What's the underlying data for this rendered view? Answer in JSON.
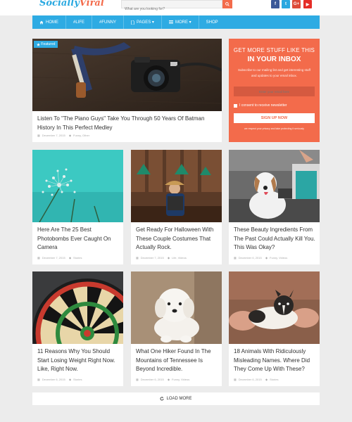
{
  "header": {
    "logo_part1": "Socially",
    "logo_part2": "Viral",
    "search_placeholder": "What are you looking for?"
  },
  "social": [
    {
      "icon": "facebook-icon",
      "glyph": "f",
      "color": "#3b5998"
    },
    {
      "icon": "twitter-icon",
      "glyph": "t",
      "color": "#29a8e0"
    },
    {
      "icon": "google-plus-icon",
      "glyph": "G+",
      "color": "#dd4b39"
    },
    {
      "icon": "youtube-icon",
      "glyph": "▶",
      "color": "#e52d27"
    }
  ],
  "nav": {
    "home": "HOME",
    "life": "#LIFE",
    "funny": "#FUNNY",
    "pages": "PAGES",
    "more": "MORE",
    "shop": "SHOP"
  },
  "featured": {
    "badge": "Featured",
    "title": "Listen To \"The Piano Guys\" Take You Through 50 Years Of Batman History In This Perfect Medley",
    "date": "December 7, 2015",
    "category": "Funny, Other"
  },
  "subscribe": {
    "heading": "GET MORE STUFF LIKE THIS",
    "heading2": "IN YOUR INBOX",
    "text": "Subscribe to our mailing list and get interesting stuff and updates to your email inbox.",
    "email_placeholder": "Enter your email here",
    "consent": "I consent to receive newsletter",
    "button": "SIGN UP NOW",
    "privacy": "we respect your privacy and take protecting it seriously"
  },
  "posts": [
    {
      "title": "Here Are The 25 Best Photobombs Ever Caught On Camera",
      "date": "December 7, 2015",
      "category": "Stories"
    },
    {
      "title": "Get Ready For Halloween With These Couple Costumes That Actually Rock.",
      "date": "December 7, 2015",
      "category": "Life, Videos"
    },
    {
      "title": "These Beauty Ingredients From The Past Could Actually Kill You. This Was Okay?",
      "date": "December 6, 2015",
      "category": "Funny, Videos"
    },
    {
      "title": "11 Reasons Why You Should Start Losing Weight Right Now. Like, Right Now.",
      "date": "December 6, 2015",
      "category": "Stories"
    },
    {
      "title": "What One Hiker Found In The Mountains of Tennessee Is Beyond Incredible.",
      "date": "December 6, 2015",
      "category": "Funny, Videos"
    },
    {
      "title": "18 Animals With Ridiculously Misleading Names. Where Did They Come Up With These?",
      "date": "December 6, 2015",
      "category": "Stories"
    }
  ],
  "load_more": "LOAD MORE",
  "colors": {
    "accent": "#2eabe3",
    "orange": "#f36b4b"
  }
}
